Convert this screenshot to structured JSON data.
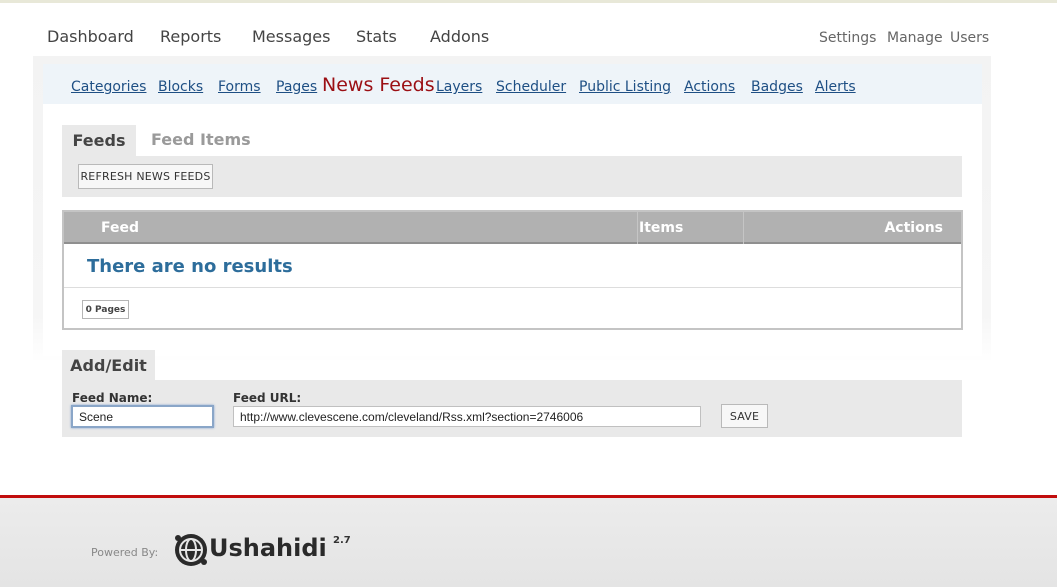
{
  "main_nav": [
    "Dashboard",
    "Reports",
    "Messages",
    "Stats",
    "Addons"
  ],
  "util_nav": [
    "Settings",
    "Manage",
    "Users"
  ],
  "sub_nav": [
    "Categories",
    "Blocks",
    "Forms",
    "Pages",
    "News Feeds",
    "Layers",
    "Scheduler",
    "Public Listing",
    "Actions",
    "Badges",
    "Alerts"
  ],
  "sub_nav_active": "News Feeds",
  "tabs": {
    "feeds": "Feeds",
    "feed_items": "Feed Items"
  },
  "toolbar": {
    "refresh_label": "REFRESH NEWS FEEDS"
  },
  "table": {
    "columns": [
      "Feed",
      "Items",
      "Actions"
    ],
    "empty_message": "There are no results",
    "pagination": "0 Pages"
  },
  "add_edit": {
    "tab_label": "Add/Edit",
    "feed_name_label": "Feed Name:",
    "feed_name_value": "Scene",
    "feed_url_label": "Feed URL:",
    "feed_url_value": "http://www.clevescene.com/cleveland/Rss.xml?section=2746006",
    "save_label": "SAVE"
  },
  "footer": {
    "powered_by": "Powered By:",
    "brand": "Ushahidi",
    "version": "2.7"
  },
  "colors": {
    "link": "#1e4f84",
    "active": "#9b0f14",
    "footer_rule": "#c10d0d",
    "empty_text": "#2d6d9b"
  }
}
